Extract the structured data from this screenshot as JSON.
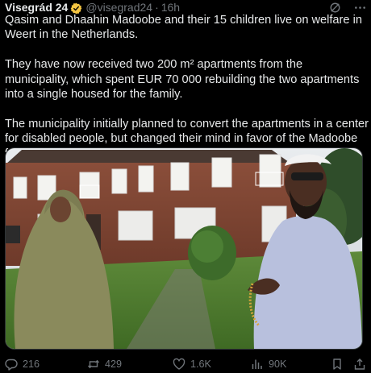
{
  "post": {
    "author_name": "Visegrád 24",
    "handle": "@visegrad24",
    "separator": "·",
    "timestamp": "16h",
    "paragraphs": [
      "Qasim and Dhaahin Madoobe and their 15 children live on welfare in Weert in the Netherlands.",
      "They have now received two 200 m² apartments from the municipality, which spent EUR 70 000 rebuilding the two apartments into a single housed for the family.",
      "The municipality initially planned to convert the apartments in a center for disabled people, but changed their mind in favor of the Madoobe family."
    ],
    "verified_badge_color": "#f4c542"
  },
  "actions": {
    "replies": "216",
    "reposts": "429",
    "likes": "1.6K",
    "views": "90K"
  },
  "icons": {
    "grok": "grok-icon",
    "more": "more-icon",
    "reply": "reply-icon",
    "repost": "repost-icon",
    "like": "heart-icon",
    "views": "views-icon",
    "bookmark": "bookmark-icon",
    "share": "share-icon"
  },
  "colors": {
    "background": "#000000",
    "text": "#e7e9ea",
    "muted": "#71767b"
  }
}
